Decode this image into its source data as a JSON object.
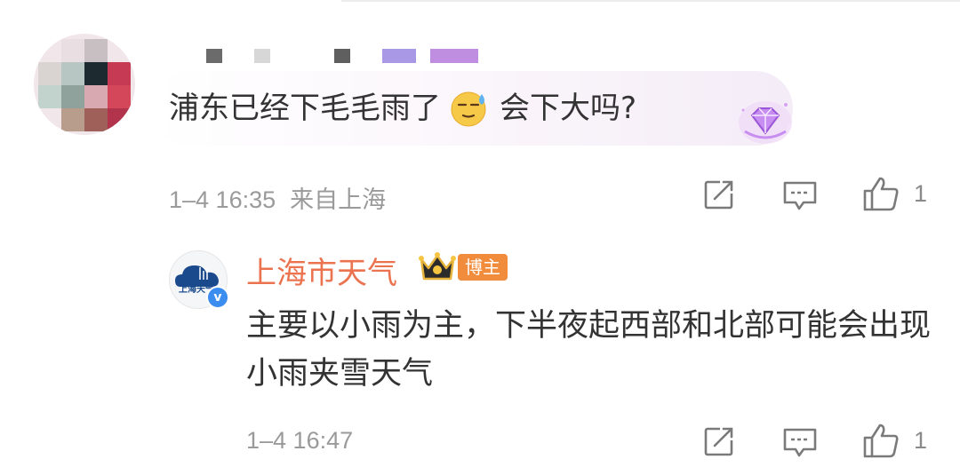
{
  "comment": {
    "text_before_emoji": "浦东已经下毛毛雨了",
    "emoji": "sweat-smile-emoji",
    "text_after_emoji": "会下大吗?",
    "time": "1–4 16:35",
    "source": "来自上海",
    "like_count": "1"
  },
  "reply": {
    "author": "上海市天气",
    "avatar_text": "上海天气",
    "verified_mark": "v",
    "badge": "博主",
    "text": "主要以小雨为主，下半夜起西部和北部可能会出现小雨夹雪天气",
    "time": "1–4 16:47",
    "like_count": "1"
  },
  "colors": {
    "author_name": "#eb7350",
    "meta_text": "#9a9a9a",
    "badge_bg": "#f08c3c",
    "verified_bg": "#3b8df0"
  }
}
